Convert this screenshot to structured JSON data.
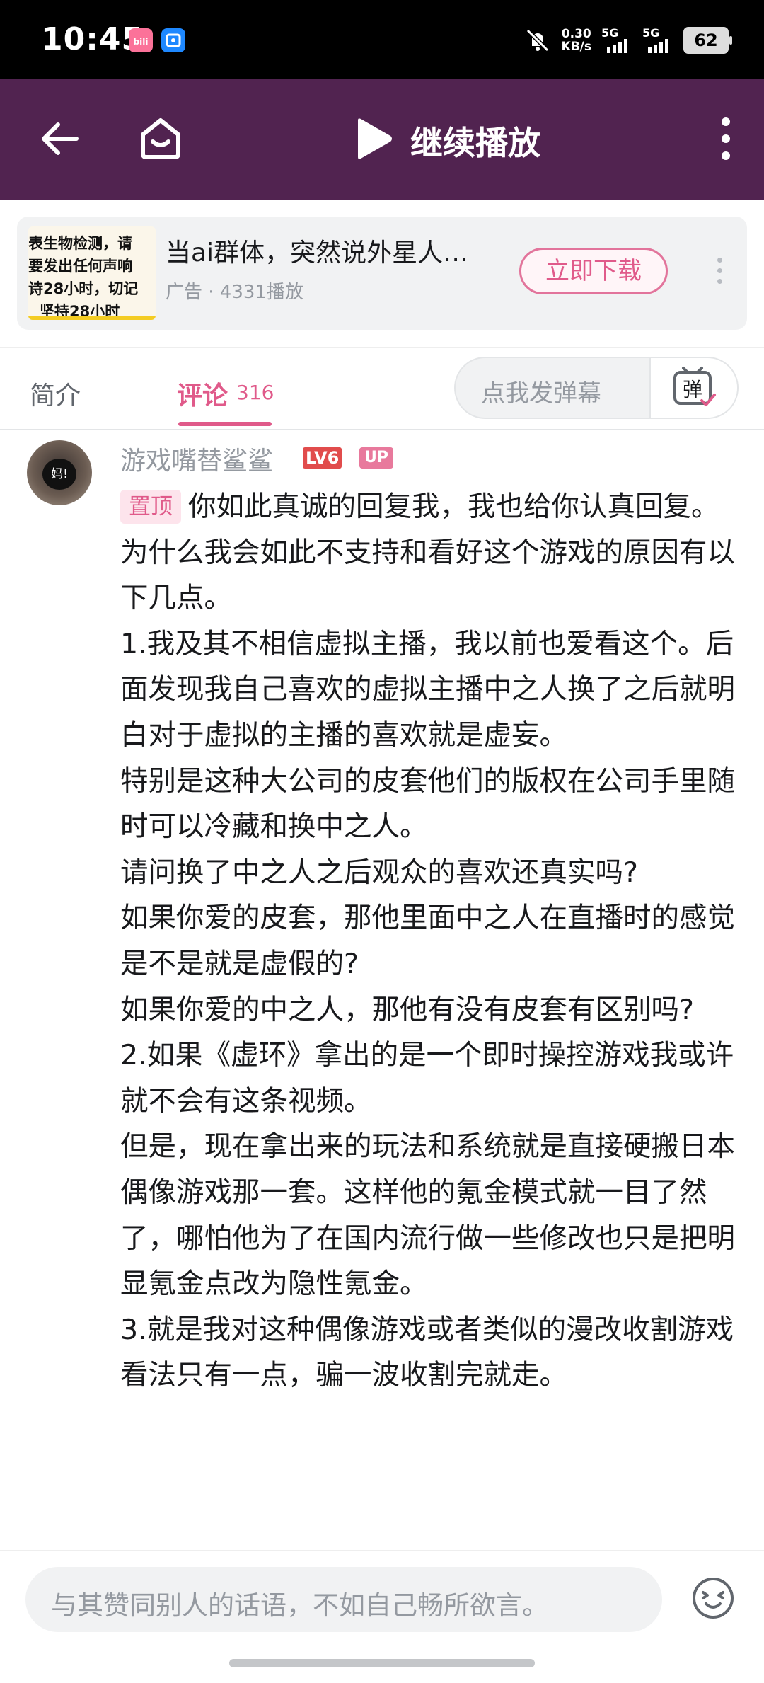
{
  "status_bar": {
    "time": "10:45",
    "net_speed_value": "0.30",
    "net_speed_unit": "KB/s",
    "sim1_label": "5G",
    "sim2_label": "5G",
    "battery": "62",
    "icons": [
      "bilibili-app-icon",
      "store-app-icon",
      "mute-icon",
      "signal-icon",
      "battery-icon"
    ]
  },
  "top_bar": {
    "title": "继续播放",
    "icons": [
      "back-arrow-icon",
      "home-icon",
      "play-icon",
      "more-vertical-icon"
    ]
  },
  "ad": {
    "thumb_lines": [
      "表生物检测，请",
      "要发出任何声响",
      "诗28小时，切记",
      "坚持28小时"
    ],
    "title": "当ai群体，突然说外星人…",
    "meta": "广告 · 4331播放",
    "download_label": "立即下载"
  },
  "tabs": {
    "intro": "简介",
    "comments": "评论",
    "comment_count": "316",
    "danmaku_placeholder": "点我发弹幕",
    "danmaku_icon_text": "弹"
  },
  "comment": {
    "avatar_text": "妈!",
    "username": "游戏嘴替鲨鲨",
    "level_badge": "LV6",
    "up_badge": "UP",
    "pin_label": "置顶",
    "paragraphs": [
      "你如此真诚的回复我，我也给你认真回复。",
      "为什么我会如此不支持和看好这个游戏的原因有以下几点。",
      "1.我及其不相信虚拟主播，我以前也爱看这个。后面发现我自己喜欢的虚拟主播中之人换了之后就明白对于虚拟的主播的喜欢就是虚妄。",
      "特别是这种大公司的皮套他们的版权在公司手里随时可以冷藏和换中之人。",
      "请问换了中之人之后观众的喜欢还真实吗?",
      "如果你爱的皮套，那他里面中之人在直播时的感觉是不是就是虚假的?",
      "如果你爱的中之人，那他有没有皮套有区别吗?",
      "2.如果《虚环》拿出的是一个即时操控游戏我或许就不会有这条视频。",
      "但是，现在拿出来的玩法和系统就是直接硬搬日本偶像游戏那一套。这样他的氪金模式就一目了然了，哪怕他为了在国内流行做一些修改也只是把明显氪金点改为隐性氪金。",
      "3.就是我对这种偶像游戏或者类似的漫改收割游戏看法只有一点，骗一波收割完就走。"
    ]
  },
  "bottom": {
    "input_placeholder": "与其赞同别人的话语，不如自己畅所欲言。"
  },
  "colors": {
    "top_bar_bg": "#512350",
    "accent_pink": "#e05a8a",
    "level_badge": "#e14c4c"
  }
}
